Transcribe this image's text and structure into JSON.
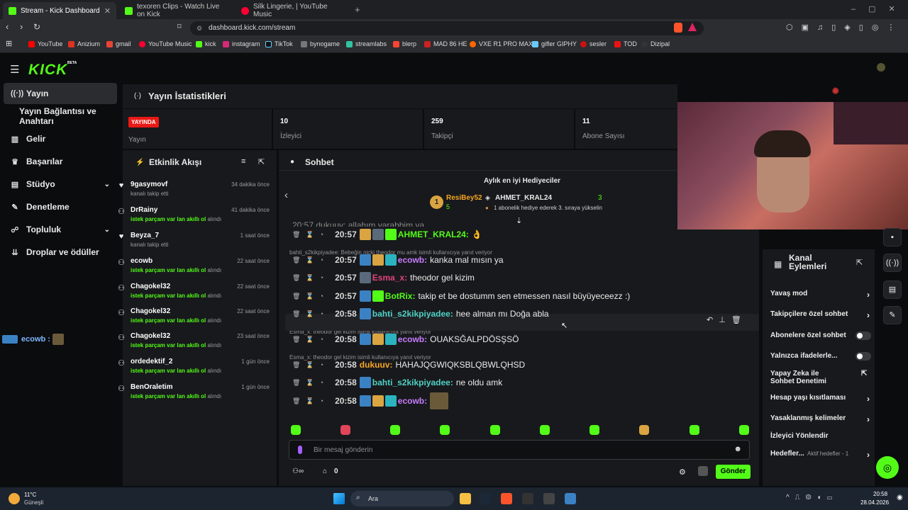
{
  "browser": {
    "tabs": [
      {
        "title": "Stream - Kick Dashboard",
        "color": "#53fc18",
        "active": true
      },
      {
        "title": "texoren Clips - Watch Live on Kick",
        "color": "#53fc18",
        "active": false
      },
      {
        "title": "Silk Lingerie, | YouTube Music",
        "color": "#ff0033",
        "active": false
      }
    ],
    "new_tab": "+",
    "url": "dashboard.kick.com/stream",
    "bookmarks": [
      "YouTube",
      "Anizium",
      "gmail",
      "YouTube Music",
      "kick",
      "instagram",
      "TikTok",
      "bynogame",
      "streamlabs",
      "blerp",
      "MAD 86 HE",
      "VXE R1 PRO MAX",
      "gifler GIPHY",
      "sesler",
      "TOD",
      "Dizipal"
    ]
  },
  "app": {
    "logo": "KICK",
    "logo_beta": "BETA",
    "nav": [
      {
        "label": "Yayın",
        "icon": "broadcast-icon",
        "active": true
      },
      {
        "label": "Yayın Bağlantısı ve Anahtarı",
        "icon": "",
        "active": false
      },
      {
        "label": "Gelir",
        "icon": "chart-icon",
        "active": false
      },
      {
        "label": "Başarılar",
        "icon": "trophy-icon",
        "active": false
      },
      {
        "label": "Stüdyo",
        "icon": "studio-icon",
        "active": false
      },
      {
        "label": "Denetleme",
        "icon": "wrench-icon",
        "active": false
      },
      {
        "label": "Topluluk",
        "icon": "community-icon",
        "active": false
      },
      {
        "label": "Droplar ve ödüller",
        "icon": "drops-icon",
        "active": false
      }
    ],
    "overlay_chat": {
      "user": "ecowb :"
    }
  },
  "stats": {
    "title": "Yayın İstatistikleri",
    "live_badge": "YAYINDA",
    "live_label": "Yayın",
    "viewers_value": "10",
    "viewers_label": "İzleyici",
    "followers_value": "259",
    "followers_label": "Takipçi",
    "subs_value": "11",
    "subs_label": "Abone Sayısı"
  },
  "activity": {
    "title": "Etkinlik Akışı",
    "items": [
      {
        "name": "9gasymovf",
        "sub": "kanalı takip etti",
        "time": "34 dakika önce",
        "type": "follow"
      },
      {
        "name": "DrRainy",
        "sub_bold": "istek parçam var lan akıllı ol",
        "sub_rest": " alındı",
        "time": "41 dakika önce",
        "type": "reward"
      },
      {
        "name": "Beyza_7",
        "sub": "kanalı takip etti",
        "time": "1 saat önce",
        "type": "follow"
      },
      {
        "name": "ecowb",
        "sub_bold": "istek parçam var lan akıllı ol",
        "sub_rest": " alındı",
        "time": "22 saat önce",
        "type": "reward"
      },
      {
        "name": "Chagokel32",
        "sub_bold": "istek parçam var lan akıllı ol",
        "sub_rest": " alındı",
        "time": "22 saat önce",
        "type": "reward"
      },
      {
        "name": "Chagokel32",
        "sub_bold": "istek parçam var lan akıllı ol",
        "sub_rest": " alındı",
        "time": "22 saat önce",
        "type": "reward"
      },
      {
        "name": "Chagokel32",
        "sub_bold": "istek parçam var lan akıllı ol",
        "sub_rest": " alındı",
        "time": "23 saat önce",
        "type": "reward"
      },
      {
        "name": "ordedektif_2",
        "sub_bold": "istek parçam var lan akıllı ol",
        "sub_rest": " alındı",
        "time": "1 gün önce",
        "type": "reward"
      },
      {
        "name": "BenOraletim",
        "sub_bold": "istek parçam var lan akıllı ol",
        "sub_rest": " alındı",
        "time": "1 gün önce",
        "type": "reward"
      }
    ]
  },
  "chat": {
    "title": "Sohbet",
    "gifters_title": "Aylık en iyi Hediyeciler",
    "top_gifter": {
      "name": "ResiBey52",
      "count": "5",
      "rank": "1"
    },
    "second_gifter": {
      "name": "AHMET_KRAL24",
      "count": "3"
    },
    "gift_notice": "1 abonelik hediye ederek 3. sıraya yükselin",
    "messages": [
      {
        "time": "20:57",
        "user": "AHMET_KRAL24:",
        "color": "#53fc18",
        "text": "👌",
        "reply": ""
      },
      {
        "time": "20:57",
        "user": "ecowb:",
        "color": "#c77dff",
        "text": "kanka mal mısın ya",
        "reply": "bahti_s2kikpiyadee: Bebeğin nicki theodor mu amk isimli kullanıcıya yanıt veriyor"
      },
      {
        "time": "20:57",
        "user": "Esma_x:",
        "color": "#e0457b",
        "text": "theodor gel kizim",
        "reply": ""
      },
      {
        "time": "20:57",
        "user": "BotRix:",
        "color": "#53fc18",
        "text": "takip et be dostumm sen etmessen nasıl büyüyeceezz :)",
        "reply": ""
      },
      {
        "time": "20:58",
        "user": "bahti_s2kikpiyadee:",
        "color": "#4fd1c5",
        "text": "hee alman mı Doğa abla",
        "reply": ""
      },
      {
        "time": "20:58",
        "user": "ecowb:",
        "color": "#c77dff",
        "text": "OUAKSĞALPDÖSŞSÖ",
        "reply": "Esma_x: theodor gel kizim isimli kullanıcıya yanıt veriyor"
      },
      {
        "time": "20:58",
        "user": "dukuuv:",
        "color": "#f5a623",
        "text": "HAHAJQGWIQKSBLQBWLQHSD",
        "reply": "Esma_x: theodor gel kizim isimli kullanıcıya yanıt veriyor"
      },
      {
        "time": "20:58",
        "user": "bahti_s2kikpiyadee:",
        "color": "#4fd1c5",
        "text": "ne oldu amk",
        "reply": ""
      },
      {
        "time": "20:58",
        "user": "ecowb:",
        "color": "#c77dff",
        "text": "",
        "reply": ""
      }
    ],
    "partial_top": "20:57 dukuuv: allahım yarabbim ya",
    "input_placeholder": "Bir mesaj gönderin",
    "points": "0",
    "send_label": "Gönder"
  },
  "channel_actions": {
    "title": "Kanal Eylemleri",
    "items": [
      {
        "label": "Yavaş mod",
        "control": "arrow"
      },
      {
        "label": "Takipçilere özel sohbet",
        "control": "arrow"
      },
      {
        "label": "Abonelere özel sohbet",
        "control": "toggle"
      },
      {
        "label": "Yalnızca ifadelerle...",
        "control": "toggle"
      },
      {
        "label": "Yapay Zeka ile Sohbet Denetimi",
        "control": "external"
      },
      {
        "label": "Hesap yaşı kısıtlaması",
        "control": "arrow"
      },
      {
        "label": "Yasaklanmış kelimeler",
        "control": "arrow"
      },
      {
        "label": "İzleyici Yönlendir",
        "control": "none"
      },
      {
        "label": "Hedefler...",
        "control": "arrow"
      }
    ],
    "goals_status": "Aktif hedefler - 1"
  },
  "taskbar": {
    "weather_temp": "11°C",
    "weather_desc": "Güneşli",
    "search": "Ara",
    "time": "20:58",
    "date": "28.04.2026"
  },
  "colors": {
    "kick_green": "#53fc18",
    "panel": "#18191c",
    "live_red": "#e91916"
  }
}
